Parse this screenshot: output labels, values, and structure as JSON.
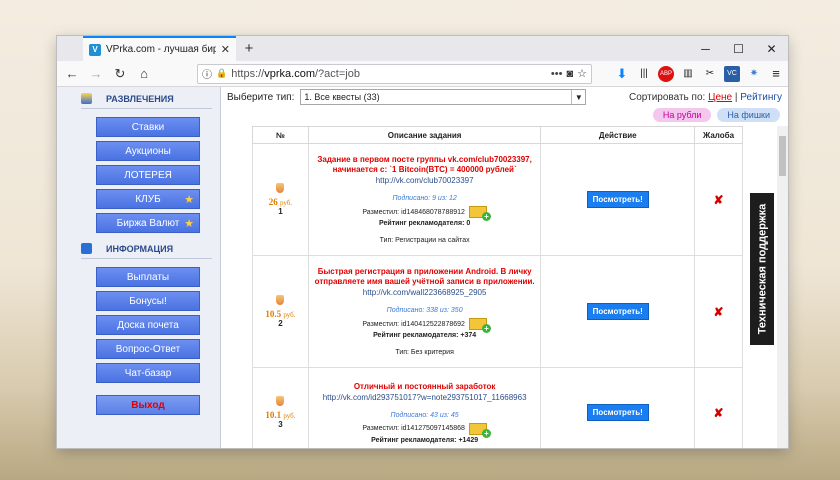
{
  "browser": {
    "tab_title": "VPrka.com - лучшая биржа о",
    "favicon_text": "V",
    "url_prefix": "https://",
    "url_host": "vprka.com",
    "url_path": "/?act=job",
    "url_dots": "•••",
    "ext_abp": "ABP",
    "ext_vc": "VC"
  },
  "sidebar": {
    "section1": "РАЗВЛЕЧЕНИЯ",
    "items1": [
      "Ставки",
      "Аукционы",
      "ЛОТЕРЕЯ",
      "КЛУБ",
      "Биржа Валют"
    ],
    "section2": "ИНФОРМАЦИЯ",
    "items2": [
      "Выплаты",
      "Бонусы!",
      "Доска почета",
      "Вопрос-Ответ",
      "Чат-базар"
    ],
    "exit": "Выход"
  },
  "filter": {
    "label": "Выберите тип:",
    "selected": "1. Все квесты (33)",
    "sort_label": "Сортировать по:",
    "sort_price": "Цене",
    "sort_sep": "|",
    "sort_rating": "Рейтингу",
    "pill_rub": "На рубли",
    "pill_chips": "На фишки"
  },
  "table": {
    "headers": [
      "№",
      "Описание задания",
      "Действие",
      "Жалоба"
    ],
    "view_label": "Посмотреть!",
    "rows": [
      {
        "price": "26",
        "currency": "руб.",
        "num": "1",
        "title": "Задание в первом посте группы vk.com/club70023397, начинается с: `1 Bitcoin(BTC) = 400000 рублей`",
        "link": "http://vk.com/club70023397",
        "subs": "Подписано: 9 из: 12",
        "poster": "Разместил: id148468078788912",
        "rating": "Рейтинг рекламодателя: 0",
        "type": "Тип: Регистрации на сайтах"
      },
      {
        "price": "10.5",
        "currency": "руб.",
        "num": "2",
        "title": "Быстрая регистрация в приложении Android. В личку отправляете имя вашей учётной записи в приложении.",
        "link": "http://vk.com/wall223668925_2905",
        "subs": "Подписано: 338 из: 350",
        "poster": "Разместил: id140412522878692",
        "rating": "Рейтинг рекламодателя: +374",
        "type": "Тип: Без критерия"
      },
      {
        "price": "10.1",
        "currency": "руб.",
        "num": "3",
        "title": "Отличный и постоянный заработок",
        "link": "http://vk.com/id293751017?w=note293751017_11668963",
        "subs": "Подписано: 43 из: 45",
        "poster": "Разместил: id141275097145868",
        "rating": "Рейтинг рекламодателя: +1429",
        "type": ""
      }
    ]
  },
  "support": "Техническая поддержка"
}
